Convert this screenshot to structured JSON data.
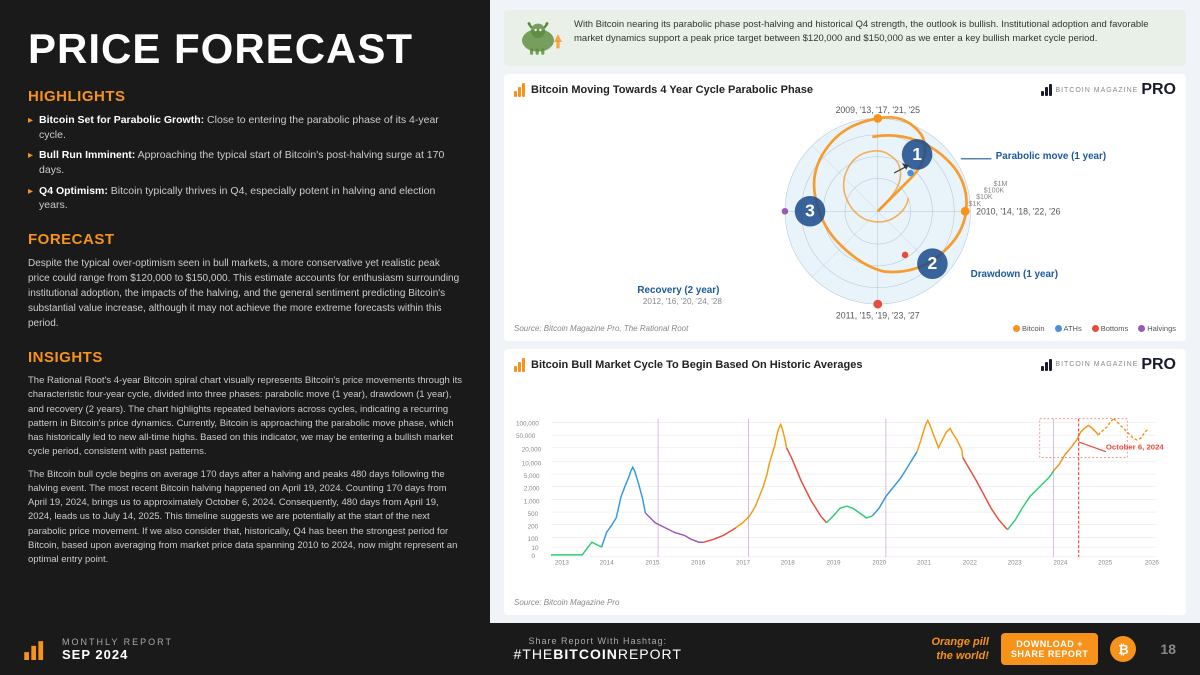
{
  "page": {
    "title": "PRICE FORECAST",
    "background": "#1a1a1a"
  },
  "highlights": {
    "heading": "HIGHLIGHTS",
    "items": [
      {
        "bold": "Bitcoin Set for Parabolic Growth:",
        "text": " Close to entering the parabolic phase of its 4-year cycle."
      },
      {
        "bold": "Bull Run Imminent:",
        "text": " Approaching the typical start of Bitcoin's post-halving surge at 170 days."
      },
      {
        "bold": "Q4 Optimism:",
        "text": " Bitcoin typically thrives in Q4, especially potent in halving and election years."
      }
    ]
  },
  "forecast": {
    "heading": "FORECAST",
    "text": "Despite the typical over-optimism seen in bull markets, a more conservative yet realistic peak price could range from $120,000 to $150,000. This estimate accounts for enthusiasm surrounding institutional adoption, the impacts of the halving, and the general sentiment predicting Bitcoin's substantial value increase, although it may not achieve the more extreme forecasts within this period."
  },
  "insights": {
    "heading": "INSIGHTS",
    "paragraphs": [
      "The Rational Root's 4-year Bitcoin spiral chart visually represents Bitcoin's price movements through its characteristic four-year cycle, divided into three phases: parabolic move (1 year), drawdown (1 year), and recovery (2 years). The chart highlights repeated behaviors across cycles, indicating a recurring pattern in Bitcoin's price dynamics. Currently, Bitcoin is approaching the parabolic move phase, which has historically led to new all-time highs. Based on this indicator, we may be entering a bullish market cycle period, consistent with past patterns.",
      "The Bitcoin bull cycle begins on average 170 days after a halving and peaks 480 days following the halving event. The most recent Bitcoin halving happened on April 19, 2024. Counting 170 days from April 19, 2024, brings us to approximately October 6, 2024. Consequently, 480 days from April 19, 2024, leads us to July 14, 2025. This timeline suggests we are potentially at the start of the next parabolic price movement. If we also consider that, historically, Q4 has been the strongest period for Bitcoin, based upon averaging from market price data spanning 2010 to 2024, now might represent an optimal entry point."
    ]
  },
  "callout": {
    "text": "With Bitcoin nearing its parabolic phase post-halving and historical Q4 strength, the outlook is bullish. Institutional adoption and favorable market dynamics support a peak price target between $120,000 and $150,000 as we enter a key bullish market cycle period."
  },
  "spiral_chart": {
    "title": "Bitcoin Moving Towards 4 Year Cycle Parabolic Phase",
    "source": "Source: Bitcoin Magazine Pro, The Rational Root",
    "labels": {
      "parabolic": "Parabolic move (1 year)",
      "recovery": "Recovery (2 year)",
      "recovery_years": "2012, '16, '20, '24, '28",
      "drawdown": "Drawdown (1 year)",
      "year_top": "2009, '13, '17, '21, '25",
      "year_right": "2010, '14, '18, '22, '26",
      "year_bottom": "2011, '15, '19, '23, '27",
      "phase_1": "1",
      "phase_2": "2",
      "phase_3": "3"
    },
    "legend": [
      {
        "label": "Bitcoin",
        "color": "#f7931a"
      },
      {
        "label": "ATHs",
        "color": "#4a90d9"
      },
      {
        "label": "Bottoms",
        "color": "#e74c3c"
      },
      {
        "label": "Halvings",
        "color": "#9b59b6"
      }
    ]
  },
  "line_chart": {
    "title": "Bitcoin Bull Market Cycle To Begin Based On Historic Averages",
    "source": "Source: Bitcoin Magazine Pro",
    "annotation": "October 6, 2024",
    "y_axis": [
      "100,000",
      "50,000",
      "20,000",
      "10,000",
      "5,000",
      "2,000",
      "1,000",
      "500",
      "200",
      "100",
      "10",
      "0"
    ],
    "x_axis": [
      "2013",
      "2014",
      "2015",
      "2016",
      "2017",
      "2018",
      "2019",
      "2020",
      "2021",
      "2022",
      "2023",
      "2024",
      "2025",
      "2026"
    ]
  },
  "footer": {
    "report_label": "MONTHLY REPORT",
    "report_date": "SEP 2024",
    "hashtag_label": "Share Report With Hashtag:",
    "hashtag": "#THE",
    "hashtag_bold": "BITCOIN",
    "hashtag_end": "REPORT",
    "orange_pill_line1": "Orange pill",
    "orange_pill_line2": "the world!",
    "download_btn": "DOWNLOAD +\nSHARE REPORT",
    "page_number": "18"
  }
}
